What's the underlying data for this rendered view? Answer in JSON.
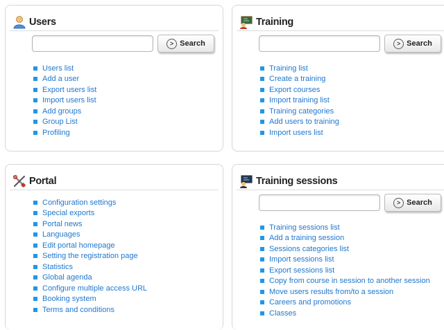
{
  "users": {
    "title": "Users",
    "search_placeholder": "",
    "search_label": "Search",
    "links": [
      "Users list",
      "Add a user",
      "Export users list",
      "Import users list",
      "Add groups",
      "Group List",
      "Profiling"
    ]
  },
  "training": {
    "title": "Training",
    "search_placeholder": "",
    "search_label": "Search",
    "links": [
      "Training list",
      "Create a training",
      "Export courses",
      "Import training list",
      "Training categories",
      "Add users to training",
      "Import users list"
    ]
  },
  "portal": {
    "title": "Portal",
    "links": [
      "Configuration settings",
      "Special exports",
      "Portal news",
      "Languages",
      "Edit portal homepage",
      "Setting the registration page",
      "Statistics",
      "Global agenda",
      "Configure multiple access URL",
      "Booking system",
      "Terms and conditions"
    ]
  },
  "sessions": {
    "title": "Training sessions",
    "search_placeholder": "",
    "search_label": "Search",
    "links": [
      "Training sessions list",
      "Add a training session",
      "Sessions categories list",
      "Import sessions list",
      "Export sessions list",
      "Copy from course in session to another session",
      "Move users results from/to a session",
      "Careers and promotions",
      "Classes"
    ]
  },
  "colors": {
    "link": "#1f77cf",
    "bullet": "#2196e8",
    "border": "#d6d6d6"
  },
  "icons": {
    "users": "user-icon",
    "training": "blackboard-icon",
    "portal": "tools-icon",
    "sessions": "blackboard-icon"
  }
}
